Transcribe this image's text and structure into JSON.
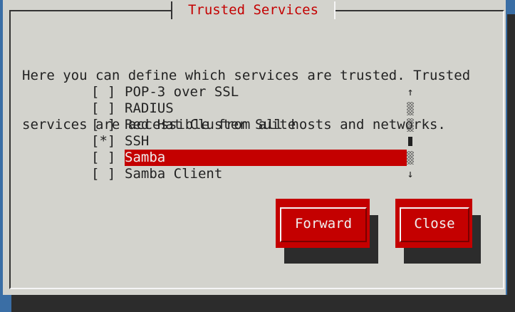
{
  "dialog": {
    "title": "Trusted Services",
    "intro_lines": [
      "Here you can define which services are trusted. Trusted",
      "services are accessible from all hosts and networks."
    ]
  },
  "services": [
    {
      "check": "[ ]",
      "label": "POP-3 over SSL",
      "checked": false,
      "selected": false
    },
    {
      "check": "[ ]",
      "label": "RADIUS",
      "checked": false,
      "selected": false
    },
    {
      "check": "[ ]",
      "label": "Red Hat Cluster Suite",
      "checked": false,
      "selected": false
    },
    {
      "check": "[*]",
      "label": "SSH",
      "checked": true,
      "selected": false
    },
    {
      "check": "[ ]",
      "label": "Samba",
      "checked": false,
      "selected": true
    },
    {
      "check": "[ ]",
      "label": "Samba Client",
      "checked": false,
      "selected": false
    }
  ],
  "scrollbar": {
    "up_glyph": "↑",
    "down_glyph": "↓",
    "thumb_row": 3
  },
  "buttons": {
    "forward_label": "Forward",
    "close_label": "Close"
  },
  "colors": {
    "accent": "#c40000",
    "dialog_bg": "#d3d3cd",
    "desktop_bg": "#3a6ea5",
    "shadow": "#2c2c2c"
  }
}
